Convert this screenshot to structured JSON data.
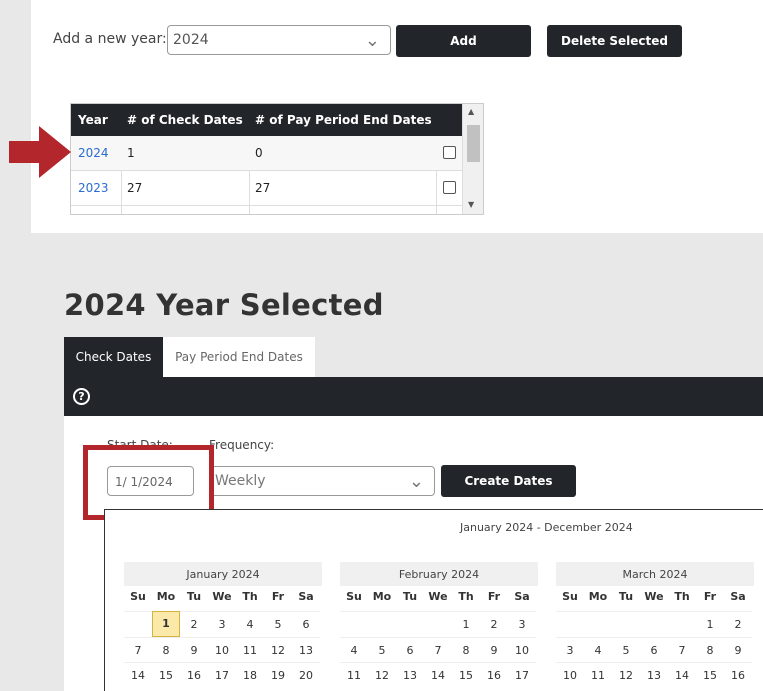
{
  "add_year": {
    "label": "Add a new year:",
    "select_value": "2024",
    "add_button": "Add",
    "delete_button": "Delete Selected"
  },
  "year_table": {
    "headers": [
      "Year",
      "# of Check Dates",
      "# of Pay Period End Dates"
    ],
    "rows": [
      {
        "year": "2024",
        "check_dates": "1",
        "pay_period_end_dates": "0"
      },
      {
        "year": "2023",
        "check_dates": "27",
        "pay_period_end_dates": "27"
      }
    ]
  },
  "heading": "2024 Year Selected",
  "tabs": [
    "Check Dates",
    "Pay Period End Dates"
  ],
  "form": {
    "start_date_label": "Start Date:",
    "start_date_value": "1/ 1/2024",
    "frequency_label": "Frequency:",
    "frequency_value": "Weekly",
    "create_button": "Create Dates"
  },
  "calendar": {
    "range_title": "January 2024 - December 2024",
    "weekdays": [
      "Su",
      "Mo",
      "Tu",
      "We",
      "Th",
      "Fr",
      "Sa"
    ],
    "months": [
      {
        "name": "January 2024",
        "offset": 1,
        "days": 20,
        "highlight": 1
      },
      {
        "name": "February 2024",
        "offset": 4,
        "days": 17,
        "highlight": null
      },
      {
        "name": "March 2024",
        "offset": 5,
        "days": 16,
        "highlight": null
      }
    ]
  },
  "colors": {
    "dark": "#22262b",
    "link": "#2a6ccf",
    "annotation_red": "#b3262b",
    "highlight_day": "#fbe9a9"
  }
}
